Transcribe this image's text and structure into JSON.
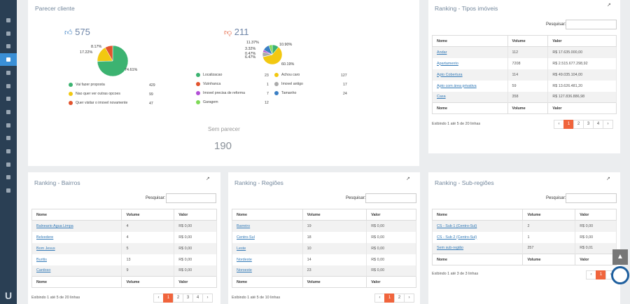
{
  "colors": {
    "sidebar": "#2a3f54",
    "active": "#3a8fd6",
    "accent": "#f0643c",
    "link": "#337ab7"
  },
  "sidebar": {
    "items": [
      {
        "icon": "users-icon"
      },
      {
        "icon": "diamond-icon"
      },
      {
        "icon": "building-icon"
      },
      {
        "icon": "home-icon"
      },
      {
        "icon": "phone-icon"
      },
      {
        "icon": "tools-icon"
      },
      {
        "icon": "calendar-icon"
      },
      {
        "icon": "list-icon"
      },
      {
        "icon": "calendar-alt-icon"
      },
      {
        "icon": "dollar-icon"
      },
      {
        "icon": "file-icon"
      },
      {
        "icon": "search-icon"
      },
      {
        "icon": "refresh-icon"
      },
      {
        "icon": "cogs-icon"
      }
    ]
  },
  "parecer": {
    "title": "Parecer cliente",
    "likes": "575",
    "dislikes": "211",
    "pos_pcts": [
      "8.17%",
      "17.22%",
      "74.61%"
    ],
    "neg_pcts": [
      "11.37%",
      "3.32%",
      "0.47%",
      "5.69%",
      "10.90%",
      "60.19%"
    ],
    "neg_pcts_small": "6.47%",
    "pos_legend": [
      {
        "label": "Vai fazer proposta",
        "value": "429",
        "color": "#3cb371"
      },
      {
        "label": "Nao quer ver outras opcoes",
        "value": "99",
        "color": "#f2c811"
      },
      {
        "label": "Quer visitar o imovel novamente",
        "value": "47",
        "color": "#e2532d"
      }
    ],
    "neg_legend": [
      {
        "label": "Localizacao",
        "value": "23",
        "color": "#3cb371"
      },
      {
        "label": "Achou caro",
        "value": "127",
        "color": "#f2c811"
      },
      {
        "label": "Vizinhanca",
        "value": "1",
        "color": "#e2532d"
      },
      {
        "label": "Imovel antigo",
        "value": "17",
        "color": "#aaaaaa"
      },
      {
        "label": "Imovel precisa de reforma",
        "value": "7",
        "color": "#b24fd6"
      },
      {
        "label": "Tamanho",
        "value": "24",
        "color": "#3a7fc4"
      },
      {
        "label": "Garagem",
        "value": "12",
        "color": "#7ed957"
      }
    ],
    "sem_title": "Sem parecer",
    "sem_value": "190"
  },
  "tipos": {
    "title": "Ranking - Tipos imóveis",
    "search_label": "Pesquisar:",
    "headers": [
      "Nome",
      "Volume",
      "Valor"
    ],
    "rows": [
      [
        "Andar",
        "112",
        "R$ 17.635.000,00"
      ],
      [
        "Apartamento",
        "7208",
        "R$ 2.515.677.298,92"
      ],
      [
        "Apto Cobertura",
        "114",
        "R$ 49.035.104,00"
      ],
      [
        "Apto com área privativa",
        "59",
        "R$ 13.626.481,20"
      ],
      [
        "Casa",
        "358",
        "R$ 127.836.886,98"
      ]
    ],
    "info": "Exibindo 1 até 5 de 20 linhas",
    "pages": [
      "‹",
      "1",
      "2",
      "3",
      "4",
      "›"
    ]
  },
  "bairros": {
    "title": "Ranking - Bairros",
    "search_label": "Pesquisar:",
    "headers": [
      "Nome",
      "Volume",
      "Valor"
    ],
    "rows": [
      [
        "Balneario Agua Limpa",
        "4",
        "R$ 0,00"
      ],
      [
        "Belvedere",
        "4",
        "R$ 0,00"
      ],
      [
        "Bom Jesus",
        "5",
        "R$ 0,00"
      ],
      [
        "Buritis",
        "13",
        "R$ 0,00"
      ],
      [
        "Cardoso",
        "9",
        "R$ 0,00"
      ]
    ],
    "info": "Exibindo 1 até 5 de 20 linhas",
    "pages": [
      "‹",
      "1",
      "2",
      "3",
      "4",
      "›"
    ]
  },
  "regioes": {
    "title": "Ranking - Regiões",
    "search_label": "Pesquisar:",
    "headers": [
      "Nome",
      "Volume",
      "Valor"
    ],
    "rows": [
      [
        "Barreiro",
        "19",
        "R$ 0,00"
      ],
      [
        "Centro-Sul",
        "18",
        "R$ 0,00"
      ],
      [
        "Leste",
        "10",
        "R$ 0,00"
      ],
      [
        "Nordeste",
        "14",
        "R$ 0,00"
      ],
      [
        "Noroeste",
        "23",
        "R$ 0,00"
      ]
    ],
    "info": "Exibindo 1 até 5 de 10 linhas",
    "pages": [
      "‹",
      "1",
      "2",
      "›"
    ]
  },
  "subregioes": {
    "title": "Ranking - Sub-regiões",
    "search_label": "Pesquisar:",
    "headers": [
      "Nome",
      "Volume",
      "Valor"
    ],
    "rows": [
      [
        "CS - Sub 1 (Centro-Sul)",
        "2",
        "R$ 0,00"
      ],
      [
        "CS - Sub 2 (Centro-Sul)",
        "1",
        "R$ 0,00"
      ],
      [
        "Sem sub-região",
        "257",
        "R$ 0,01"
      ]
    ],
    "info": "Exibindo 1 até 3 de 3 linhas",
    "pages": [
      "‹",
      "1",
      "›"
    ]
  }
}
